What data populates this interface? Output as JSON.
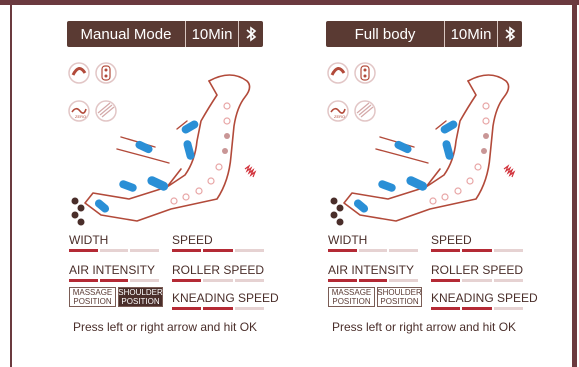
{
  "panels": [
    {
      "mode": "Manual Mode",
      "time": "10Min",
      "labels": {
        "width": "WIDTH",
        "speed": "SPEED",
        "air_intensity": "AIR INTENSITY",
        "roller_speed": "ROLLER SPEED",
        "kneading_speed": "KNEADING SPEED"
      },
      "position_buttons": [
        {
          "line1": "MASSAGE",
          "line2": "POSITION",
          "selected": false
        },
        {
          "line1": "SHOULDER",
          "line2": "POSITION",
          "selected": true
        }
      ],
      "icons": [
        "flip-icon",
        "vibration-icon",
        "zero-gravity-icon",
        "heat-icon",
        "bluetooth-icon"
      ],
      "levels": {
        "width": 1,
        "speed": 2,
        "air_intensity": 2,
        "roller_speed": 1,
        "kneading_speed": 2
      },
      "footer": "Press left or right arrow and hit OK"
    },
    {
      "mode": "Full body",
      "time": "10Min",
      "labels": {
        "width": "WIDTH",
        "speed": "SPEED",
        "air_intensity": "AIR INTENSITY",
        "roller_speed": "ROLLER SPEED",
        "kneading_speed": "KNEADING SPEED"
      },
      "position_buttons": [
        {
          "line1": "MASSAGE",
          "line2": "POSITION",
          "selected": false
        },
        {
          "line1": "SHOULDER",
          "line2": "POSITION",
          "selected": false
        }
      ],
      "icons": [
        "flip-icon",
        "vibration-icon",
        "zero-gravity-icon",
        "heat-icon",
        "bluetooth-icon"
      ],
      "levels": {
        "width": 1,
        "speed": 2,
        "air_intensity": 2,
        "roller_speed": 1,
        "kneading_speed": 2
      },
      "footer": "Press left or right arrow and hit OK"
    }
  ],
  "colors": {
    "header_bg": "#5a3a33",
    "accent_red": "#b42a35",
    "frame": "#6b3a3f",
    "body_blue": "#2a8fd6",
    "body_outline": "#b24a3a"
  }
}
